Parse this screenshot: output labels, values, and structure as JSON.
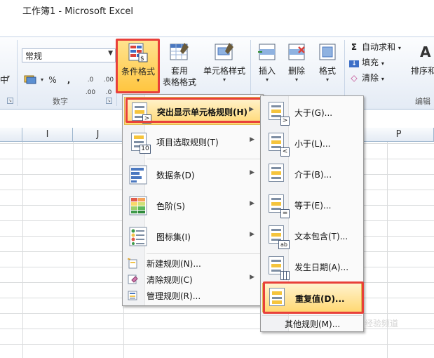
{
  "window": {
    "title": "工作簿1  -  Microsoft Excel"
  },
  "ribbon": {
    "left_partial_label": "中",
    "number": {
      "format_value": "常规",
      "buttons": [
        "%",
        ",",
        ".00→.0",
        ".0→.00"
      ],
      "group_label": "数字"
    },
    "styles": {
      "conditional_format_label": "条件格式",
      "table_format_label_1": "套用",
      "table_format_label_2": "表格格式",
      "cell_styles_label": "单元格样式"
    },
    "cells": {
      "insert_label": "插入",
      "delete_label": "删除",
      "format_label": "格式"
    },
    "editing": {
      "autosum_label": "自动求和",
      "fill_label": "填充",
      "clear_label": "清除",
      "sort_label": "排序和",
      "group_label": "编辑"
    }
  },
  "sheet": {
    "columns": [
      "I",
      "J",
      "P"
    ]
  },
  "cf_menu": {
    "items": [
      {
        "label": "突出显示单元格规则(H)",
        "icon": "highlight-cells-icon",
        "submenu": true,
        "active": true
      },
      {
        "label": "项目选取规则(T)",
        "icon": "top-bottom-icon",
        "submenu": true
      },
      {
        "label": "数据条(D)",
        "icon": "data-bars-icon",
        "submenu": true
      },
      {
        "label": "色阶(S)",
        "icon": "color-scale-icon",
        "submenu": true
      },
      {
        "label": "图标集(I)",
        "icon": "icon-sets-icon",
        "submenu": true
      }
    ],
    "small_items": [
      {
        "label": "新建规则(N)...",
        "icon": "new-rule-icon"
      },
      {
        "label": "清除规则(C)",
        "icon": "clear-rules-icon",
        "submenu": true
      },
      {
        "label": "管理规则(R)...",
        "icon": "manage-rules-icon"
      }
    ]
  },
  "highlight_submenu": {
    "items": [
      {
        "label": "大于(G)...",
        "icon": "greater-than-icon"
      },
      {
        "label": "小于(L)...",
        "icon": "less-than-icon"
      },
      {
        "label": "介于(B)...",
        "icon": "between-icon"
      },
      {
        "label": "等于(E)...",
        "icon": "equal-to-icon"
      },
      {
        "label": "文本包含(T)...",
        "icon": "text-contains-icon"
      },
      {
        "label": "发生日期(A)...",
        "icon": "date-occurring-icon"
      },
      {
        "label": "重复值(D)...",
        "icon": "duplicate-values-icon",
        "active": true
      }
    ],
    "other_label": "其他规则(M)..."
  },
  "colors": {
    "annotation_red": "#e8403a",
    "active_item": "#ffd873",
    "ribbon_bg": "#e4ebf5"
  },
  "watermark": "经验频道"
}
